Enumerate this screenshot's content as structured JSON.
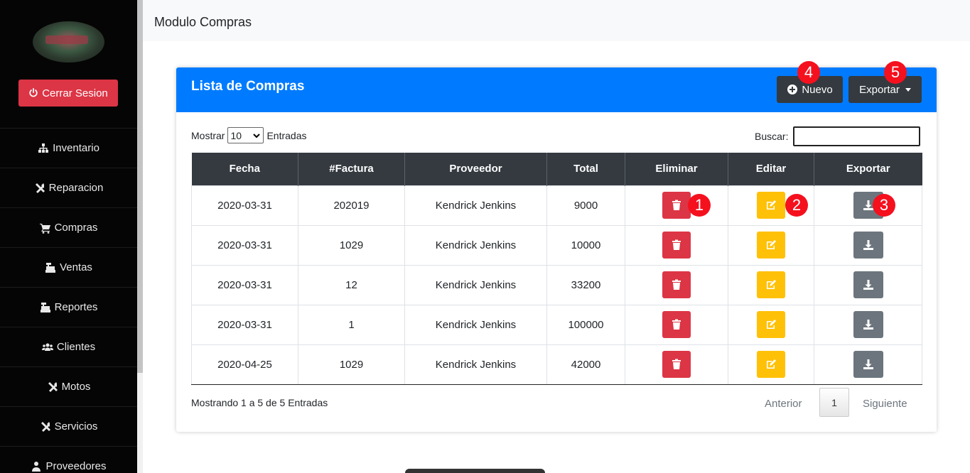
{
  "sidebar": {
    "logout_label": "Cerrar Sesion",
    "items": [
      {
        "label": "Inventario",
        "icon": "sitemap-icon"
      },
      {
        "label": "Reparacion",
        "icon": "tools-icon"
      },
      {
        "label": "Compras",
        "icon": "cart-icon"
      },
      {
        "label": "Ventas",
        "icon": "cash-register-icon"
      },
      {
        "label": "Reportes",
        "icon": "cash-register-icon"
      },
      {
        "label": "Clientes",
        "icon": "users-icon"
      },
      {
        "label": "Motos",
        "icon": "tools-icon"
      },
      {
        "label": "Servicios",
        "icon": "tools-icon"
      },
      {
        "label": "Proveedores",
        "icon": "user-tie-icon"
      }
    ]
  },
  "header": {
    "title": "Modulo Compras"
  },
  "card": {
    "title": "Lista de Compras",
    "new_label": "Nuevo",
    "export_label": "Exportar",
    "length_prefix": "Mostrar",
    "length_value": "10",
    "length_suffix": "Entradas",
    "search_label": "Buscar:",
    "search_value": ""
  },
  "table": {
    "columns": [
      "Fecha",
      "#Factura",
      "Proveedor",
      "Total",
      "Eliminar",
      "Editar",
      "Exportar"
    ],
    "rows": [
      {
        "fecha": "2020-03-31",
        "factura": "202019",
        "proveedor": "Kendrick Jenkins",
        "total": "9000"
      },
      {
        "fecha": "2020-03-31",
        "factura": "1029",
        "proveedor": "Kendrick Jenkins",
        "total": "10000"
      },
      {
        "fecha": "2020-03-31",
        "factura": "12",
        "proveedor": "Kendrick Jenkins",
        "total": "33200"
      },
      {
        "fecha": "2020-03-31",
        "factura": "1",
        "proveedor": "Kendrick Jenkins",
        "total": "100000"
      },
      {
        "fecha": "2020-04-25",
        "factura": "1029",
        "proveedor": "Kendrick Jenkins",
        "total": "42000"
      }
    ]
  },
  "footer": {
    "info": "Mostrando 1 a 5 de 5 Entradas",
    "prev_label": "Anterior",
    "page_label": "1",
    "next_label": "Siguiente"
  },
  "markers": [
    "1",
    "2",
    "3",
    "4",
    "5"
  ],
  "colors": {
    "primary": "#007bff",
    "danger": "#dc3545",
    "warning": "#ffc107",
    "secondary": "#6c757d",
    "dark": "#343a40",
    "marker": "#f5101e"
  }
}
